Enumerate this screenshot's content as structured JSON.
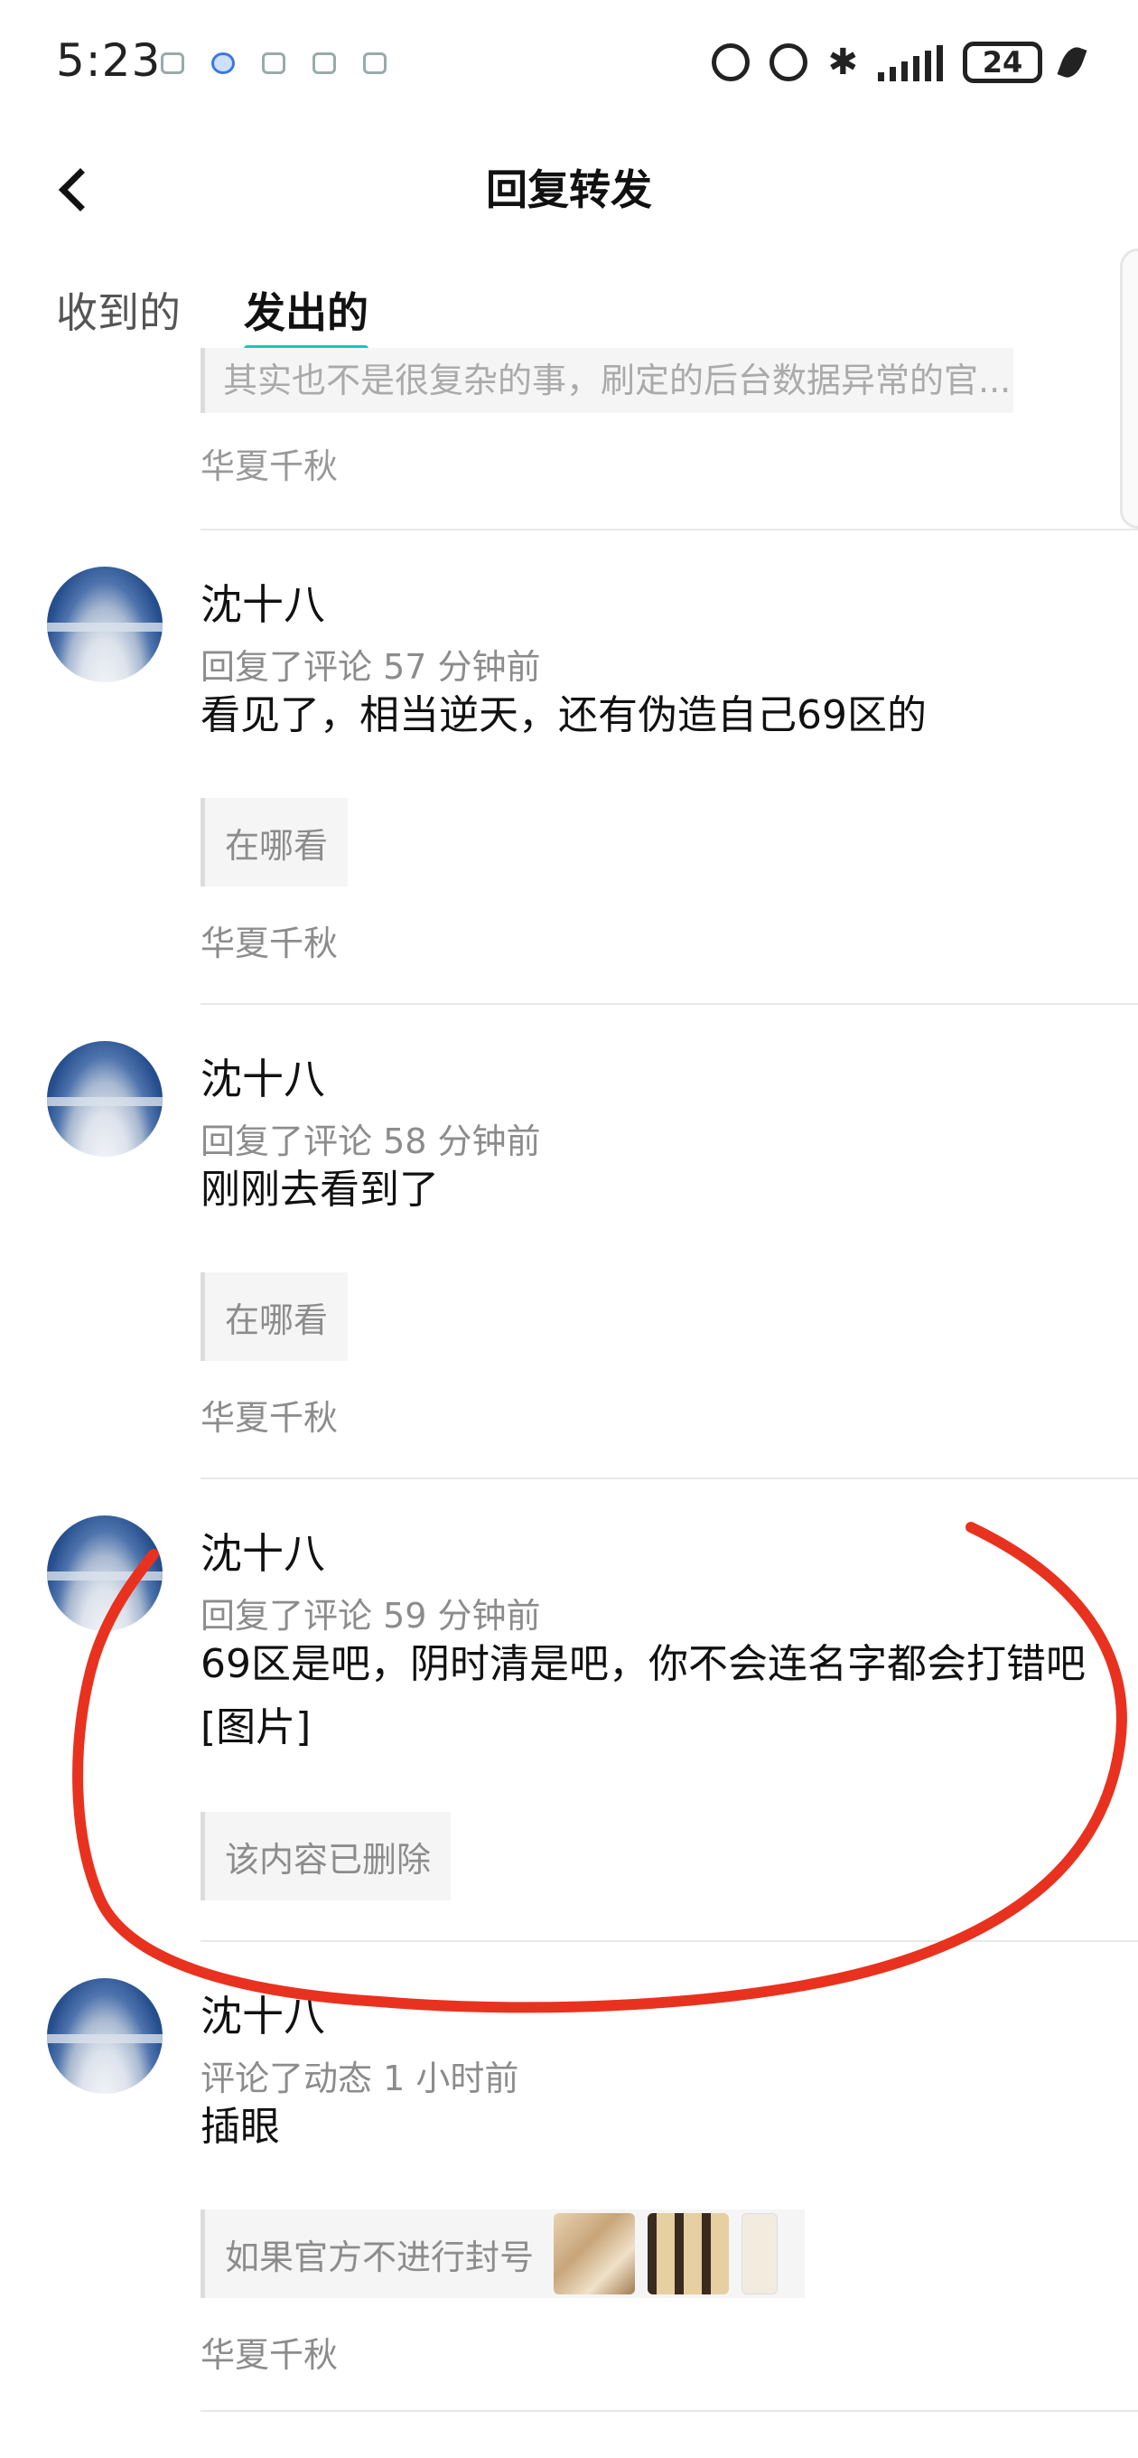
{
  "status_bar": {
    "time": "5:23",
    "battery": "24"
  },
  "header": {
    "title": "回复转发"
  },
  "tabs": [
    {
      "label": "收到的",
      "active": false
    },
    {
      "label": "发出的",
      "active": true
    }
  ],
  "feed": {
    "top_partial": {
      "quote_text": "其实也不是很复杂的事，刷定的后台数据异常的官...",
      "source": "华夏千秋"
    },
    "items": [
      {
        "username": "沈十八",
        "meta": "回复了评论 57 分钟前",
        "text": "看见了，相当逆天，还有伪造自己69区的",
        "quote": "在哪看",
        "source": "华夏千秋"
      },
      {
        "username": "沈十八",
        "meta": "回复了评论 58 分钟前",
        "text": "刚刚去看到了",
        "quote": "在哪看",
        "source": "华夏千秋"
      },
      {
        "username": "沈十八",
        "meta": "回复了评论 59 分钟前",
        "text": "69区是吧，阴时清是吧，你不会连名字都会打错吧[图片]",
        "quote": "该内容已删除",
        "source": ""
      },
      {
        "username": "沈十八",
        "meta": "评论了动态 1 小时前",
        "text": "插眼",
        "quote": "如果官方不进行封号",
        "source": "华夏千秋"
      }
    ]
  },
  "colors": {
    "accent_underline": "#18c5c5",
    "annotation": "#e8321f"
  }
}
